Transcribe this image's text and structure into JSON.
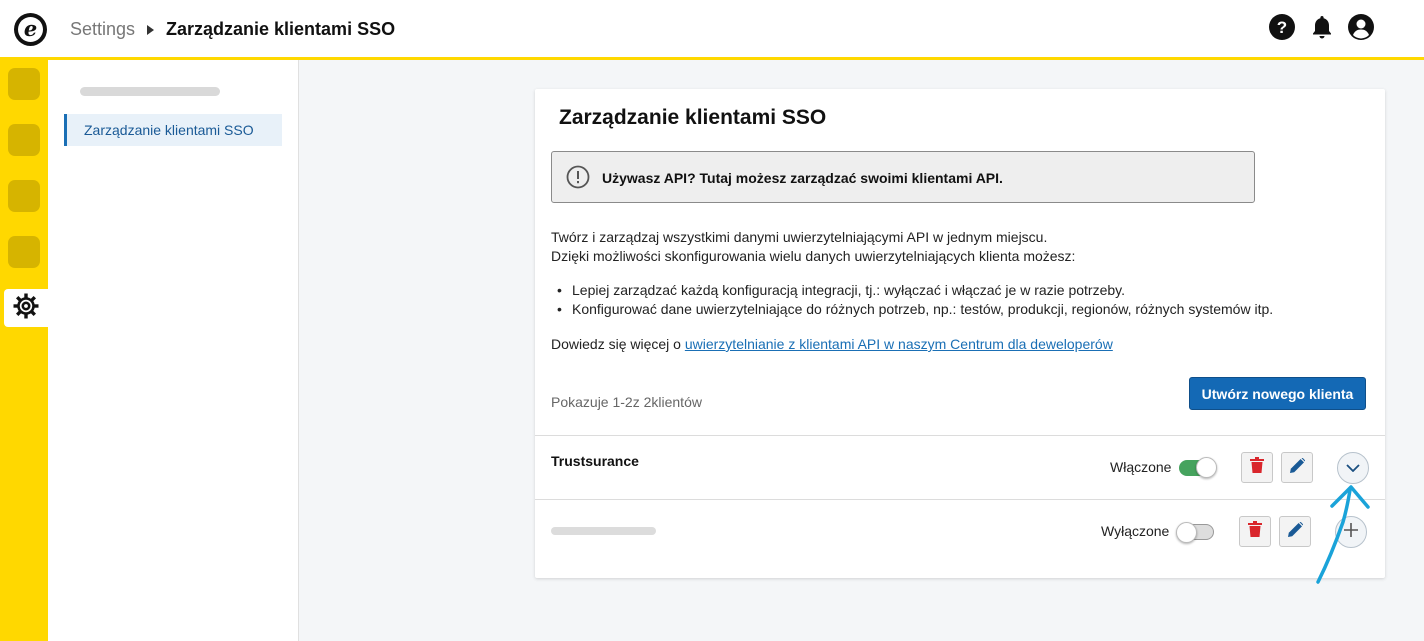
{
  "header": {
    "logo_letter": "e",
    "breadcrumb_parent": "Settings",
    "breadcrumb_current": "Zarządzanie klientami SSO",
    "icons": [
      "help-icon",
      "bell-icon",
      "user-account-icon"
    ]
  },
  "rail": {
    "items": [
      "app-tile-icon",
      "app-tile-icon",
      "app-tile-icon",
      "app-tile-icon"
    ],
    "active_icon": "gear-icon"
  },
  "subnav": {
    "active_item": "Zarządzanie klientami SSO"
  },
  "main": {
    "title": "Zarządzanie klientami SSO",
    "notice": {
      "icon": "exclamation-circle-icon",
      "text": "Używasz API? Tutaj możesz zarządzać swoimi klientami API."
    },
    "description_lines": [
      "Twórz i zarządzaj wszystkimi danymi uwierzytelniającymi API w jednym miejscu.",
      "Dzięki możliwości skonfigurowania wielu danych uwierzytelniających klienta możesz:"
    ],
    "bullets": [
      "Lepiej zarządzać każdą konfiguracją integracji, tj.: wyłączać i włączać je w razie potrzeby.",
      "Konfigurować dane uwierzytelniające do różnych potrzeb, np.: testów, produkcji, regionów, różnych systemów itp."
    ],
    "learn_more_prefix": "Dowiedz się więcej o ",
    "learn_more_link": "uwierzytelnianie z klientami API w naszym Centrum dla deweloperów",
    "count_text": "Pokazuje 1-2z 2klientów",
    "create_button": "Utwórz nowego klienta"
  },
  "clients": [
    {
      "name": "Trustsurance",
      "status_label": "Włączone",
      "enabled": true,
      "expand_icon": "chevron-down-icon"
    },
    {
      "name": "",
      "status_label": "Wyłączone",
      "enabled": false,
      "expand_icon": "plus-icon"
    }
  ],
  "colors": {
    "brand_yellow": "#ffd800",
    "primary_blue": "#1469b5",
    "toggle_on": "#46a35e",
    "delete_red": "#d9262c",
    "annotation_arrow": "#1aa3d9"
  }
}
